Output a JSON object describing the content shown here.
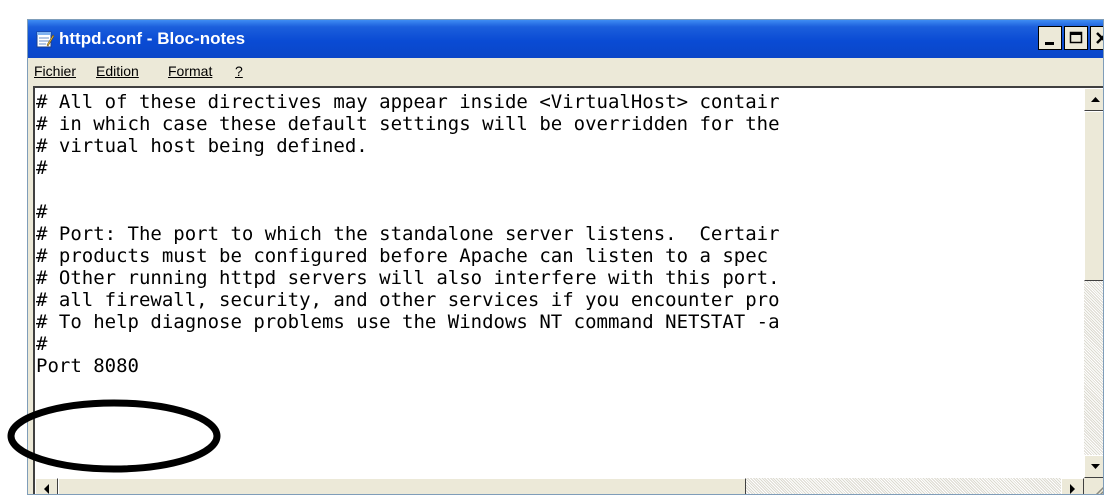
{
  "window": {
    "title": "httpd.conf - Bloc-notes",
    "title_bar_color": "#0a4bd4"
  },
  "menu": [
    {
      "label": "Fichier"
    },
    {
      "label": "Edition"
    },
    {
      "label": "Format"
    },
    {
      "label": "?"
    }
  ],
  "editor": {
    "lines": [
      "# All of these directives may appear inside <VirtualHost> contair",
      "# in which case these default settings will be overridden for the",
      "# virtual host being defined.",
      "#",
      "",
      "#",
      "# Port: The port to which the standalone server listens.  Certair",
      "# products must be configured before Apache can listen to a spec",
      "# Other running httpd servers will also interfere with this port.",
      "# all firewall, security, and other services if you encounter pro",
      "# To help diagnose problems use the Windows NT command NETSTAT -a",
      "#",
      "Port 8080"
    ]
  },
  "annotation": {
    "shape": "ellipse",
    "color": "#000000",
    "highlights": "Port 8080"
  }
}
